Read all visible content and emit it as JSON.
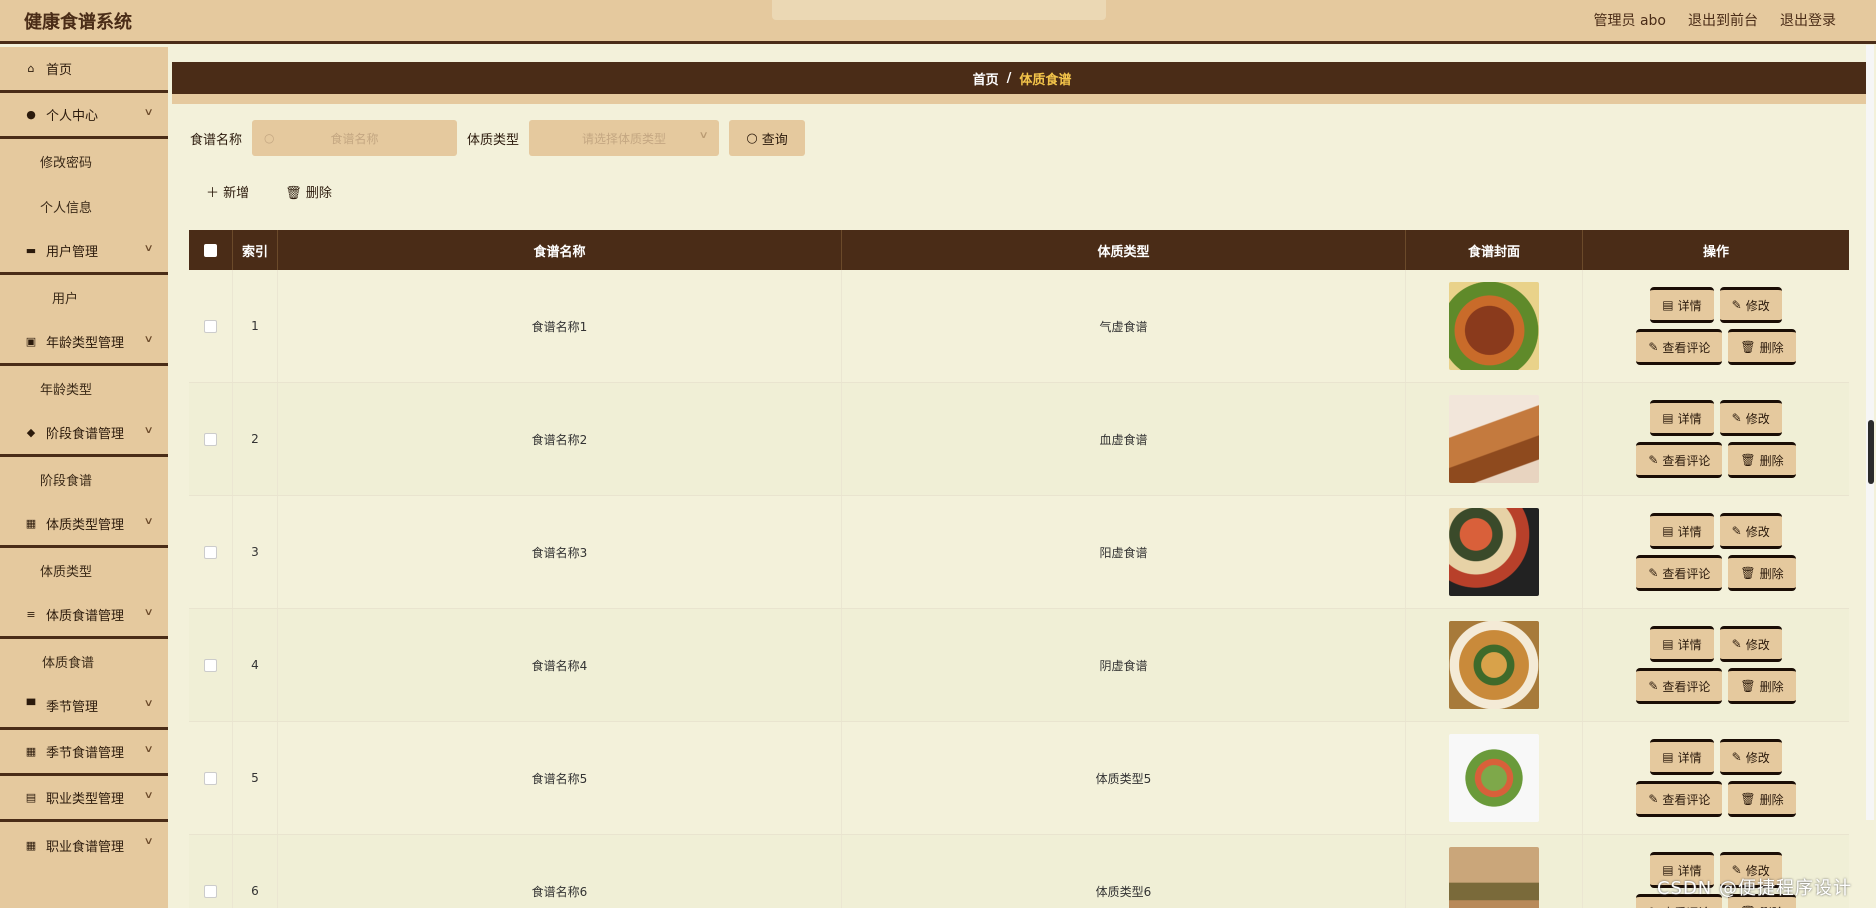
{
  "app": {
    "title": "健康食谱系统"
  },
  "header": {
    "admin": "管理员 abo",
    "back_front": "退出到前台",
    "logout": "退出登录"
  },
  "sidebar": {
    "items": [
      {
        "label": "首页",
        "icon": "home-icon"
      },
      {
        "label": "个人中心",
        "icon": "user-icon"
      },
      {
        "label": "修改密码"
      },
      {
        "label": "个人信息"
      },
      {
        "label": "用户管理",
        "icon": "chat-icon"
      },
      {
        "label": "用户"
      },
      {
        "label": "年龄类型管理",
        "icon": "calendar-icon"
      },
      {
        "label": "年龄类型"
      },
      {
        "label": "阶段食谱管理",
        "icon": "location-icon"
      },
      {
        "label": "阶段食谱"
      },
      {
        "label": "体质类型管理",
        "icon": "grid-icon"
      },
      {
        "label": "体质类型"
      },
      {
        "label": "体质食谱管理",
        "icon": "sliders-icon"
      },
      {
        "label": "体质食谱"
      },
      {
        "label": "季节管理",
        "icon": "monitor-icon"
      },
      {
        "label": "季节食谱管理",
        "icon": "grid-icon"
      },
      {
        "label": "职业类型管理",
        "icon": "clipboard-icon"
      },
      {
        "label": "职业食谱管理",
        "icon": "grid-icon"
      }
    ]
  },
  "breadcrumb": {
    "home": "首页",
    "sep": "/",
    "current": "体质食谱"
  },
  "search": {
    "name_label": "食谱名称",
    "name_placeholder": "食谱名称",
    "type_label": "体质类型",
    "type_placeholder": "请选择体质类型",
    "query_button": "查询"
  },
  "actions": {
    "add": "新增",
    "delete": "删除"
  },
  "table": {
    "headers": [
      "索引",
      "食谱名称",
      "体质类型",
      "食谱封面",
      "操作"
    ],
    "rows": [
      {
        "index": "1",
        "name": "食谱名称1",
        "type": "气虚食谱"
      },
      {
        "index": "2",
        "name": "食谱名称2",
        "type": "血虚食谱"
      },
      {
        "index": "3",
        "name": "食谱名称3",
        "type": "阳虚食谱"
      },
      {
        "index": "4",
        "name": "食谱名称4",
        "type": "阴虚食谱"
      },
      {
        "index": "5",
        "name": "食谱名称5",
        "type": "体质类型5"
      },
      {
        "index": "6",
        "name": "食谱名称6",
        "type": "体质类型6"
      }
    ],
    "ops": {
      "detail": "详情",
      "edit": "修改",
      "comments": "查看评论",
      "delete": "删除"
    }
  },
  "watermark": "CSDN @便捷程序设计",
  "colors": {
    "brown": "#4a2c17",
    "tan": "#e5c99e",
    "cream": "#f3f1da",
    "accent": "#f3c44a"
  }
}
